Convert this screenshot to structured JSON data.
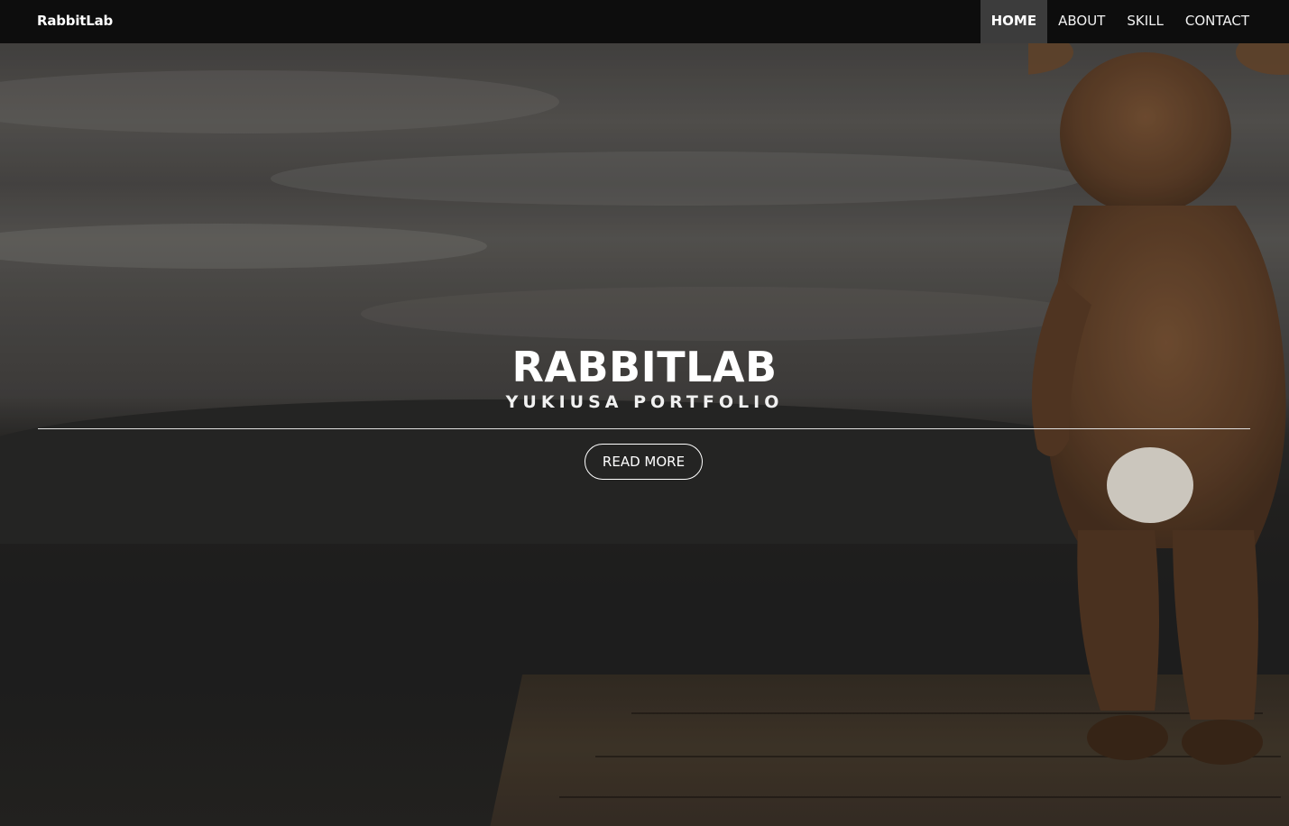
{
  "navbar": {
    "brand": "RabbitLab",
    "items": [
      {
        "label": "HOME",
        "active": true
      },
      {
        "label": "ABOUT",
        "active": false
      },
      {
        "label": "SKILL",
        "active": false
      },
      {
        "label": "CONTACT",
        "active": false
      }
    ]
  },
  "hero": {
    "title": "RABBITLAB",
    "subtitle": "YUKIUSA PORTFOLIO",
    "cta_label": "READ MORE"
  },
  "colors": {
    "navbar_bg": "#0d0d0d",
    "active_nav_bg": "#3c3c3c",
    "text": "#ffffff"
  }
}
